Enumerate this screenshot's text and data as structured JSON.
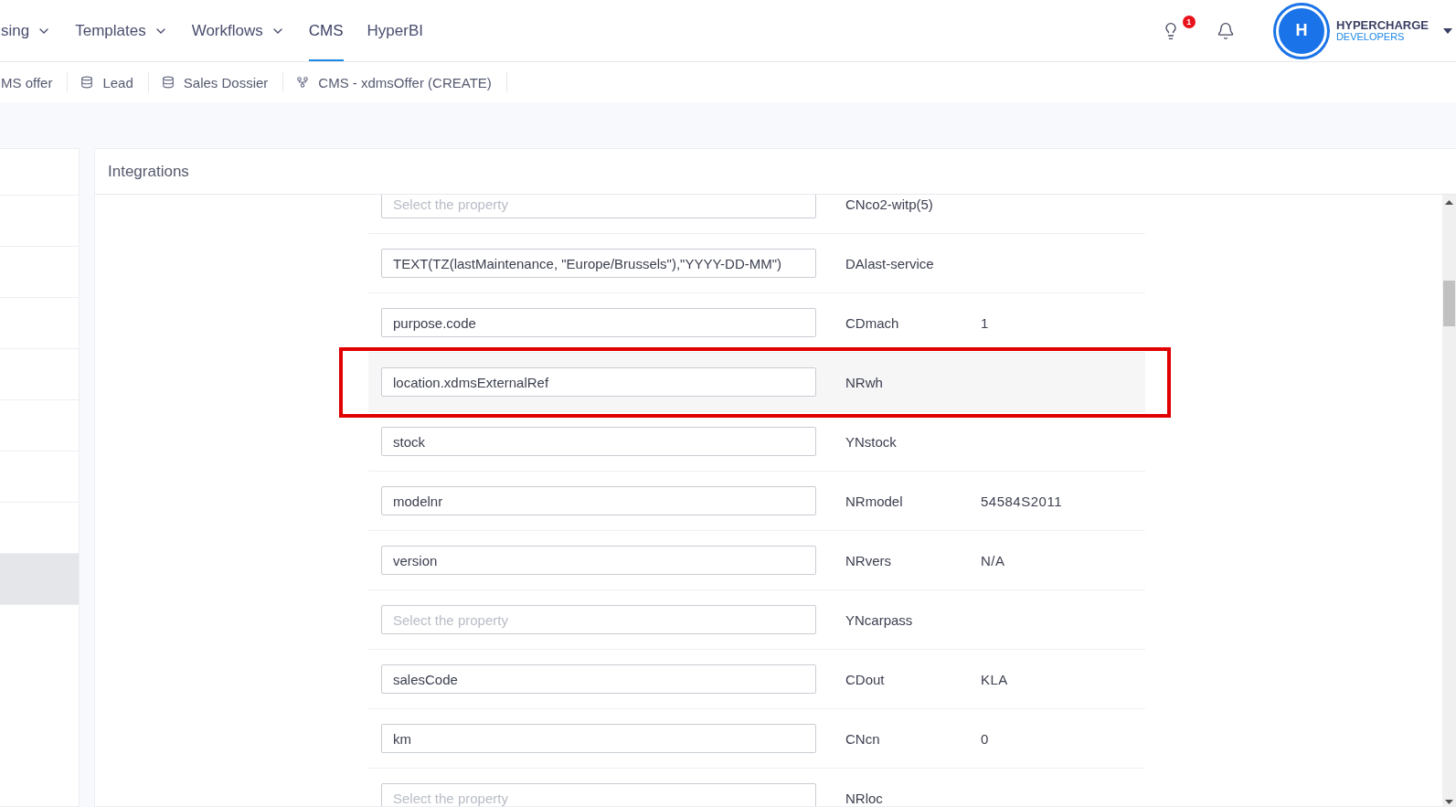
{
  "nav": {
    "items": [
      {
        "label": "sing",
        "dropdown": true,
        "selected": false
      },
      {
        "label": "Templates",
        "dropdown": true,
        "selected": false
      },
      {
        "label": "Workflows",
        "dropdown": true,
        "selected": false
      },
      {
        "label": "CMS",
        "dropdown": false,
        "selected": true
      },
      {
        "label": "HyperBI",
        "dropdown": false,
        "selected": false
      }
    ],
    "notification_badge": "1",
    "avatar": "H",
    "org_name": "HYPERCHARGE",
    "org_sub": "DEVELOPERS"
  },
  "breadcrumbs": [
    {
      "label": "MS offer",
      "kind": "plain"
    },
    {
      "label": "Lead",
      "kind": "database"
    },
    {
      "label": "Sales Dossier",
      "kind": "database"
    },
    {
      "label": "CMS - xdmsOffer (CREATE)",
      "kind": "flow"
    }
  ],
  "left_list": [
    {
      "selected": false
    },
    {
      "selected": false
    },
    {
      "selected": false
    },
    {
      "selected": false
    },
    {
      "selected": false
    },
    {
      "selected": false
    },
    {
      "selected": false
    },
    {
      "selected": true
    },
    {
      "selected": false
    }
  ],
  "panel": {
    "title": "Integrations",
    "rows": [
      {
        "value": "",
        "placeholder": "Select the property",
        "field": "CNco2-witp(5)",
        "sample": "",
        "selected": false
      },
      {
        "value": "TEXT(TZ(lastMaintenance, \"Europe/Brussels\"),\"YYYY-DD-MM\")",
        "placeholder": "",
        "field": "DAlast-service",
        "sample": "",
        "selected": false
      },
      {
        "value": "purpose.code",
        "placeholder": "",
        "field": "CDmach",
        "sample": "1",
        "selected": false
      },
      {
        "value": "location.xdmsExternalRef",
        "placeholder": "",
        "field": "NRwh",
        "sample": "",
        "selected": true
      },
      {
        "value": "stock",
        "placeholder": "",
        "field": "YNstock",
        "sample": "",
        "selected": false
      },
      {
        "value": "modelnr",
        "placeholder": "",
        "field": "NRmodel",
        "sample": "54584S2011",
        "selected": false
      },
      {
        "value": "version",
        "placeholder": "",
        "field": "NRvers",
        "sample": "N/A",
        "selected": false
      },
      {
        "value": "",
        "placeholder": "Select the property",
        "field": "YNcarpass",
        "sample": "",
        "selected": false
      },
      {
        "value": "salesCode",
        "placeholder": "",
        "field": "CDout",
        "sample": "KLA",
        "selected": false
      },
      {
        "value": "km",
        "placeholder": "",
        "field": "CNcn",
        "sample": "0",
        "selected": false
      },
      {
        "value": "",
        "placeholder": "Select the property",
        "field": "NRloc",
        "sample": "",
        "selected": false
      }
    ]
  }
}
